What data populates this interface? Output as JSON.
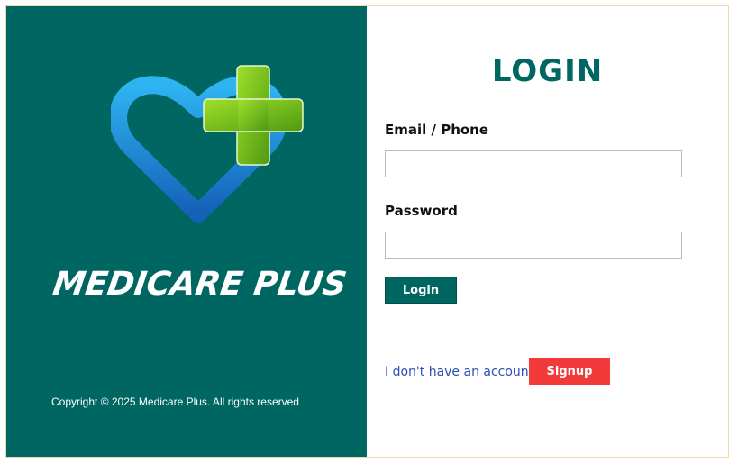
{
  "brand": {
    "name": "MEDICARE PLUS",
    "copyright": "Copyright © 2025 Medicare Plus. All rights reserved",
    "logo_icon": "heart-plus-icon",
    "colors": {
      "panel": "#006661",
      "heart": "#1e8fe0",
      "cross": "#6cc21a"
    }
  },
  "login": {
    "title": "LOGIN",
    "email_label": "Email / Phone",
    "email_value": "",
    "password_label": "Password",
    "password_value": "",
    "submit_label": "Login",
    "no_account_text": "I don't have an account",
    "signup_label": "Signup",
    "colors": {
      "accent": "#006661",
      "signup": "#f23a3a",
      "link": "#2b4fb8"
    }
  }
}
